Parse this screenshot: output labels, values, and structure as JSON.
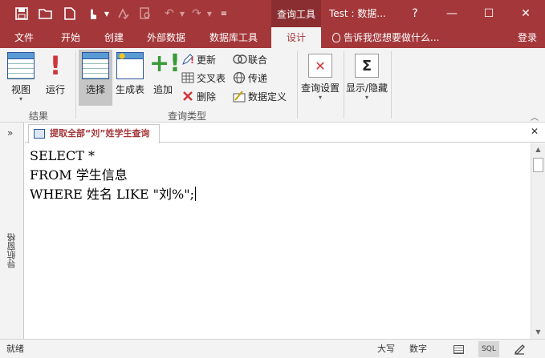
{
  "titlebar": {
    "qat": [
      "save-icon",
      "open-icon",
      "new-icon",
      "touch-mode-icon",
      "spellcheck-icon",
      "print-preview-icon",
      "undo-icon",
      "redo-icon",
      "customize-icon"
    ],
    "context_tab": "查询工具",
    "doc_title": "Test : 数据...",
    "help": "?",
    "minimize": "—",
    "maximize": "☐",
    "close": "✕",
    "bg": "#a4373a"
  },
  "tabs": {
    "items": [
      "文件",
      "开始",
      "创建",
      "外部数据",
      "数据库工具",
      "设计"
    ],
    "active": "设计",
    "tell_me": "告诉我您想要做什么...",
    "login": "登录"
  },
  "ribbon": {
    "results_group": "结果",
    "query_type_group": "查询类型",
    "view": "视图",
    "run": "运行",
    "select": "选择",
    "make_table": "生成表",
    "append": "追加",
    "update": "更新",
    "crosstab": "交叉表",
    "delete": "删除",
    "union": "联合",
    "pass_through": "传递",
    "data_definition": "数据定义",
    "query_setup": "查询设置",
    "show_hide": "显示/隐藏"
  },
  "navpane": {
    "label": "导航窗格",
    "toggle": "»"
  },
  "document": {
    "tab_label": "提取全部“刘”姓学生查询",
    "close": "✕",
    "sql_lines": [
      "SELECT *",
      "FROM 学生信息",
      "WHERE 姓名 LIKE \"刘%\";"
    ]
  },
  "statusbar": {
    "ready": "就绪",
    "caps": "大写",
    "num": "数字",
    "sql_view": "SQL"
  }
}
